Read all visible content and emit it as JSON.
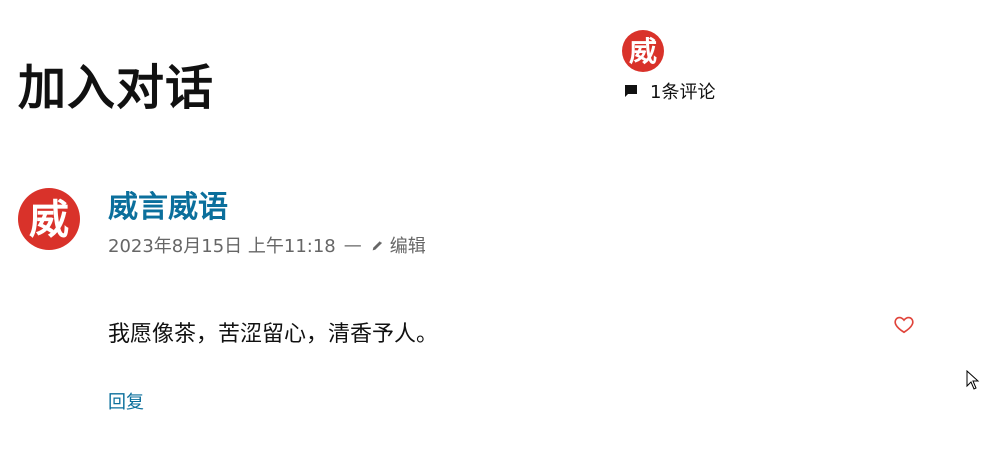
{
  "header": {
    "title": "加入对话",
    "avatar_initial": "威",
    "comment_count_label": "1条评论"
  },
  "comment": {
    "avatar_initial": "威",
    "author": "威言威语",
    "date": "2023年8月15日 上午11:18",
    "separator": "—",
    "edit_label": "编辑",
    "text": "我愿像茶，苦涩留心，清香予人。",
    "reply_label": "回复"
  },
  "icons": {
    "comment": "comment-bubble-icon",
    "edit": "pencil-icon",
    "like": "heart-icon",
    "cursor": "mouse-pointer-icon"
  },
  "colors": {
    "accent": "#0b6f9c",
    "avatar": "#d9322a",
    "heart": "#e0443b"
  }
}
